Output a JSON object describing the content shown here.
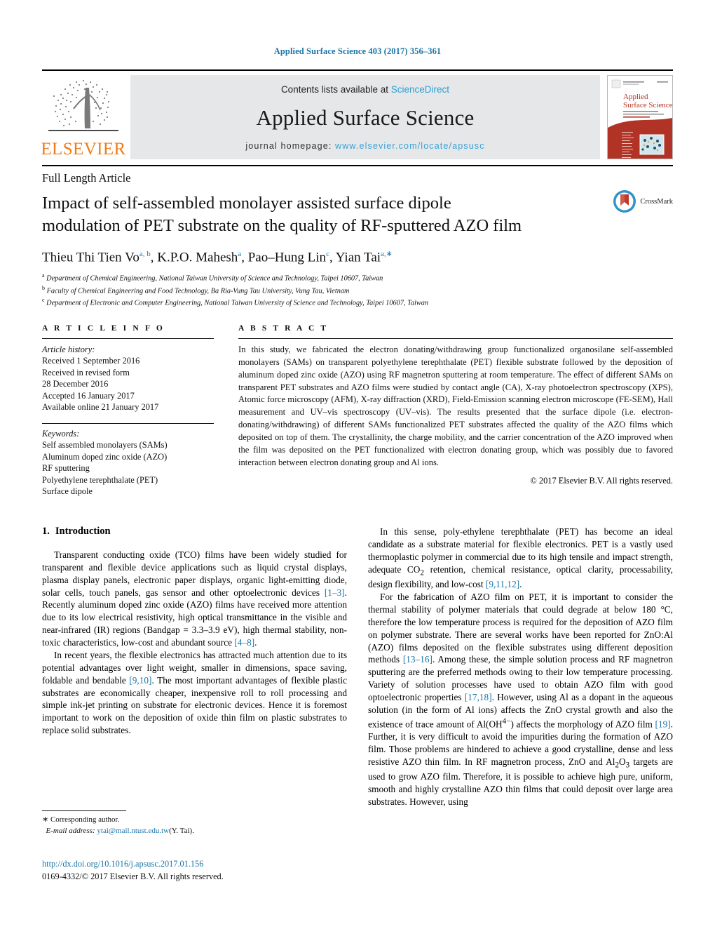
{
  "running_head": "Applied Surface Science 403 (2017) 356–361",
  "masthead": {
    "elsevier_wordmark": "ELSEVIER",
    "contents_prefix": "Contents lists available at ",
    "contents_link": "ScienceDirect",
    "journal_name": "Applied Surface Science",
    "homepage_prefix": "journal homepage: ",
    "homepage_url": "www.elsevier.com/locate/apsusc",
    "cover_title_line1": "Applied",
    "cover_title_line2": "Surface Science"
  },
  "title_block": {
    "article_type": "Full Length Article",
    "title": "Impact of self-assembled monolayer assisted surface dipole modulation of PET substrate on the quality of RF-sputtered AZO film",
    "crossmark_label": "CrossMark",
    "authors_html": "Thieu Thi Tien Vo<sup>a, b</sup>, K.P.O. Mahesh<sup>a</sup>, Pao–Hung Lin<sup>c</sup>, Yian Tai<sup>a,∗</sup>",
    "affiliations": [
      {
        "marker": "a",
        "text": "Department of Chemical Engineering, National Taiwan University of Science and Technology, Taipei 10607, Taiwan"
      },
      {
        "marker": "b",
        "text": "Faculty of Chemical Engineering and Food Technology, Ba Ria-Vung Tau University, Vung Tau, Vietnam"
      },
      {
        "marker": "c",
        "text": "Department of Electronic and Computer Engineering, National Taiwan University of Science and Technology, Taipei 10607, Taiwan"
      }
    ]
  },
  "article_info": {
    "heading": "A R T I C L E    I N F O",
    "history_label": "Article history:",
    "history": [
      "Received 1 September 2016",
      "Received in revised form",
      "28 December 2016",
      "Accepted 16 January 2017",
      "Available online 21 January 2017"
    ],
    "keywords_label": "Keywords:",
    "keywords": [
      "Self assembled monolayers (SAMs)",
      "Aluminum doped zinc oxide (AZO)",
      "RF sputtering",
      "Polyethylene terephthalate (PET)",
      "Surface dipole"
    ]
  },
  "abstract": {
    "heading": "A B S T R A C T",
    "text": "In this study, we fabricated the electron donating/withdrawing group functionalized organosilane self-assembled monolayers (SAMs) on transparent polyethylene terephthalate (PET) flexible substrate followed by the deposition of aluminum doped zinc oxide (AZO) using RF magnetron sputtering at room temperature. The effect of different SAMs on transparent PET substrates and AZO films were studied by contact angle (CA), X-ray photoelectron spectroscopy (XPS), Atomic force microscopy (AFM), X-ray diffraction (XRD), Field-Emission scanning electron microscope (FE-SEM), Hall measurement and UV–vis spectroscopy (UV–vis). The results presented that the surface dipole (i.e. electron-donating/withdrawing) of different SAMs functionalized PET substrates affected the quality of the AZO films which deposited on top of them. The crystallinity, the charge mobility, and the carrier concentration of the AZO improved when the film was deposited on the PET functionalized with electron donating group, which was possibly due to favored interaction between electron donating group and Al ions.",
    "copyright": "© 2017 Elsevier B.V. All rights reserved."
  },
  "body": {
    "section_number": "1.",
    "section_title": "Introduction",
    "left_paragraphs_html": [
      "Transparent conducting oxide (TCO) films have been widely studied for transparent and flexible device applications such as liquid crystal displays, plasma display panels, electronic paper displays, organic light-emitting diode, solar cells, touch panels, gas sensor and other optoelectronic devices <span class=\"ref\">[1–3]</span>. Recently aluminum doped zinc oxide (AZO) films have received more attention due to its low electrical resistivity, high optical transmittance in the visible and near-infrared (IR) regions (Bandgap = 3.3–3.9 eV), high thermal stability, non-toxic characteristics, low-cost and abundant source <span class=\"ref\">[4–8]</span>.",
      "In recent years, the flexible electronics has attracted much attention due to its potential advantages over light weight, smaller in dimensions, space saving, foldable and bendable <span class=\"ref\">[9,10]</span>. The most important advantages of flexible plastic substrates are economically cheaper, inexpensive roll to roll processing and simple ink-jet printing on substrate for electronic devices. Hence it is foremost important to work on the deposition of oxide thin film on plastic substrates to replace solid substrates."
    ],
    "right_paragraphs_html": [
      "In this sense, poly-ethylene terephthalate (PET) has become an ideal candidate as a substrate material for flexible electronics. PET is a vastly used thermoplastic polymer in commercial due to its high tensile and impact strength, adequate CO<sub>2</sub> retention, chemical resistance, optical clarity, processability, design flexibility, and low-cost <span class=\"ref\">[9,11,12]</span>.",
      "For the fabrication of AZO film on PET, it is important to consider the thermal stability of polymer materials that could degrade at below 180 °C, therefore the low temperature process is required for the deposition of AZO film on polymer substrate. There are several works have been reported for ZnO:Al (AZO) films deposited on the flexible substrates using different deposition methods <span class=\"ref\">[13–16]</span>. Among these, the simple solution process and RF magnetron sputtering are the preferred methods owing to their low temperature processing. Variety of solution processes have used to obtain AZO film with good optoelectronic properties <span class=\"ref\">[17,18]</span>. However, using Al as a dopant in the aqueous solution (in the form of Al ions) affects the ZnO crystal growth and also the existence of trace amount of Al(OH<sup>4−</sup>) affects the morphology of AZO film <span class=\"ref\">[19]</span>. Further, it is very difficult to avoid the impurities during the formation of AZO film. Those problems are hindered to achieve a good crystalline, dense and less resistive AZO thin film. In RF magnetron process, ZnO and Al<sub>2</sub>O<sub>3</sub> targets are used to grow AZO film. Therefore, it is possible to achieve high pure, uniform, smooth and highly crystalline AZO thin films that could deposit over large area substrates. However, using"
    ]
  },
  "footnote": {
    "star": "∗",
    "corresponding": "Corresponding author.",
    "email_label": "E-mail address:",
    "email": "ytai@mail.ntust.edu.tw",
    "email_suffix": "(Y. Tai)."
  },
  "page_footer": {
    "doi": "http://dx.doi.org/10.1016/j.apsusc.2017.01.156",
    "issn": "0169-4332/© 2017 Elsevier B.V. All rights reserved."
  },
  "colors": {
    "link_blue": "#1b75a8",
    "sciencedirect_blue": "#2e9fd4",
    "elsevier_orange": "#f07c18",
    "masthead_gray": "#e6e7e8"
  }
}
